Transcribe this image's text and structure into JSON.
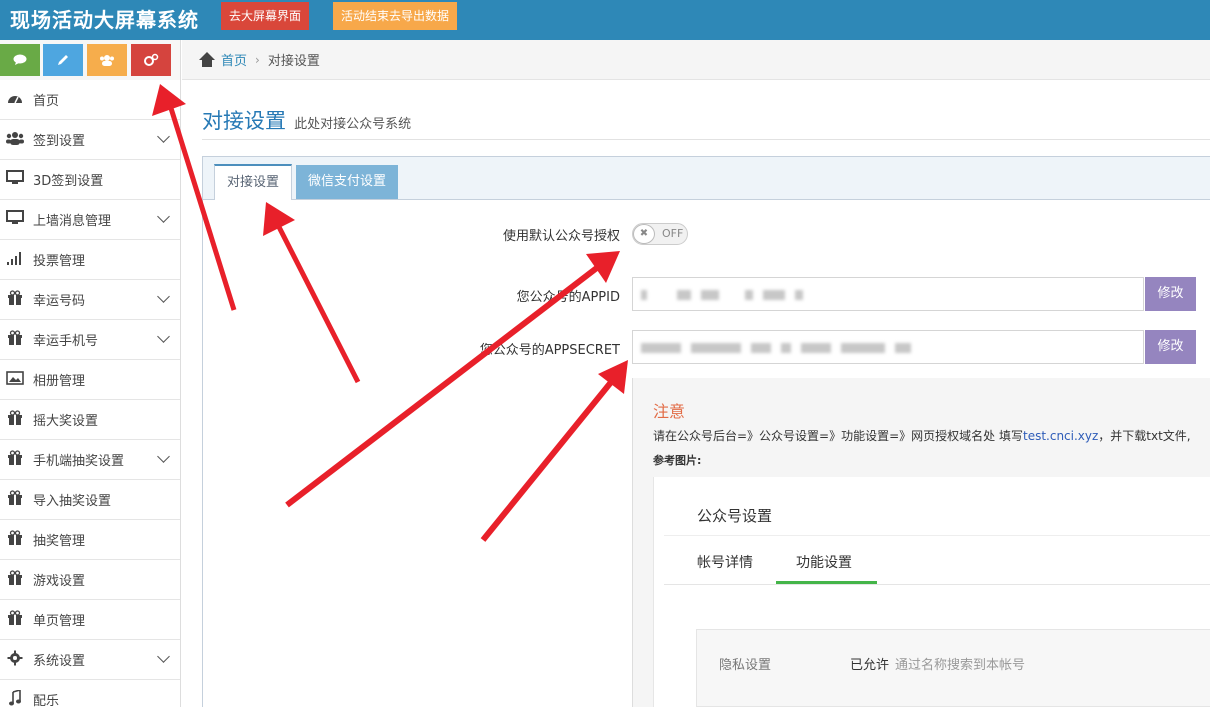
{
  "header": {
    "brand": "现场活动大屏幕系统",
    "btn_big_screen": "去大屏幕界面",
    "btn_export": "活动结束去导出数据"
  },
  "sidebar": {
    "shortcut_icons": [
      "comment-icon",
      "pencil-icon",
      "users-icon",
      "cogs-icon"
    ],
    "items": [
      {
        "label": "首页",
        "icon": "dashboard-icon",
        "expand": false
      },
      {
        "label": "签到设置",
        "icon": "users-icon",
        "expand": true
      },
      {
        "label": "3D签到设置",
        "icon": "desktop-icon",
        "expand": false
      },
      {
        "label": "上墙消息管理",
        "icon": "desktop-icon",
        "expand": true
      },
      {
        "label": "投票管理",
        "icon": "signal-icon",
        "expand": false
      },
      {
        "label": "幸运号码",
        "icon": "gift-icon",
        "expand": true
      },
      {
        "label": "幸运手机号",
        "icon": "gift-icon",
        "expand": true
      },
      {
        "label": "相册管理",
        "icon": "picture-icon",
        "expand": false
      },
      {
        "label": "摇大奖设置",
        "icon": "gift-icon",
        "expand": false
      },
      {
        "label": "手机端抽奖设置",
        "icon": "gift-icon",
        "expand": true
      },
      {
        "label": "导入抽奖设置",
        "icon": "gift-icon",
        "expand": false
      },
      {
        "label": "抽奖管理",
        "icon": "gift-icon",
        "expand": false
      },
      {
        "label": "游戏设置",
        "icon": "gift-icon",
        "expand": false
      },
      {
        "label": "单页管理",
        "icon": "gift-icon",
        "expand": false
      },
      {
        "label": "系统设置",
        "icon": "cog-icon",
        "expand": true
      },
      {
        "label": "配乐",
        "icon": "music-icon",
        "expand": false
      }
    ]
  },
  "breadcrumb": {
    "home": "首页",
    "current": "对接设置"
  },
  "page": {
    "title": "对接设置",
    "subtitle": "此处对接公众号系统"
  },
  "tabs": [
    "对接设置",
    "微信支付设置"
  ],
  "form": {
    "default_auth_label": "使用默认公众号授权",
    "toggle_state": "OFF",
    "appid_label": "您公众号的APPID",
    "appsecret_label": "您公众号的APPSECRET",
    "edit_label": "修改"
  },
  "notice": {
    "title": "注意",
    "text_before": "请在公众号后台=》公众号设置=》功能设置=》网页授权域名处 填写",
    "domain": "test.cnci.xyz",
    "text_after": "，并下载txt文件,",
    "ref_label": "参考图片:"
  },
  "ref_image": {
    "title": "公众号设置",
    "tab_account": "帐号详情",
    "tab_function": "功能设置",
    "privacy_label": "隐私设置",
    "allowed": "已允许",
    "allowed_desc": "通过名称搜索到本帐号"
  },
  "colors": {
    "topbar": "#2e88b7",
    "annotation_arrow": "#e8202a",
    "edit_button": "#9585bf"
  }
}
